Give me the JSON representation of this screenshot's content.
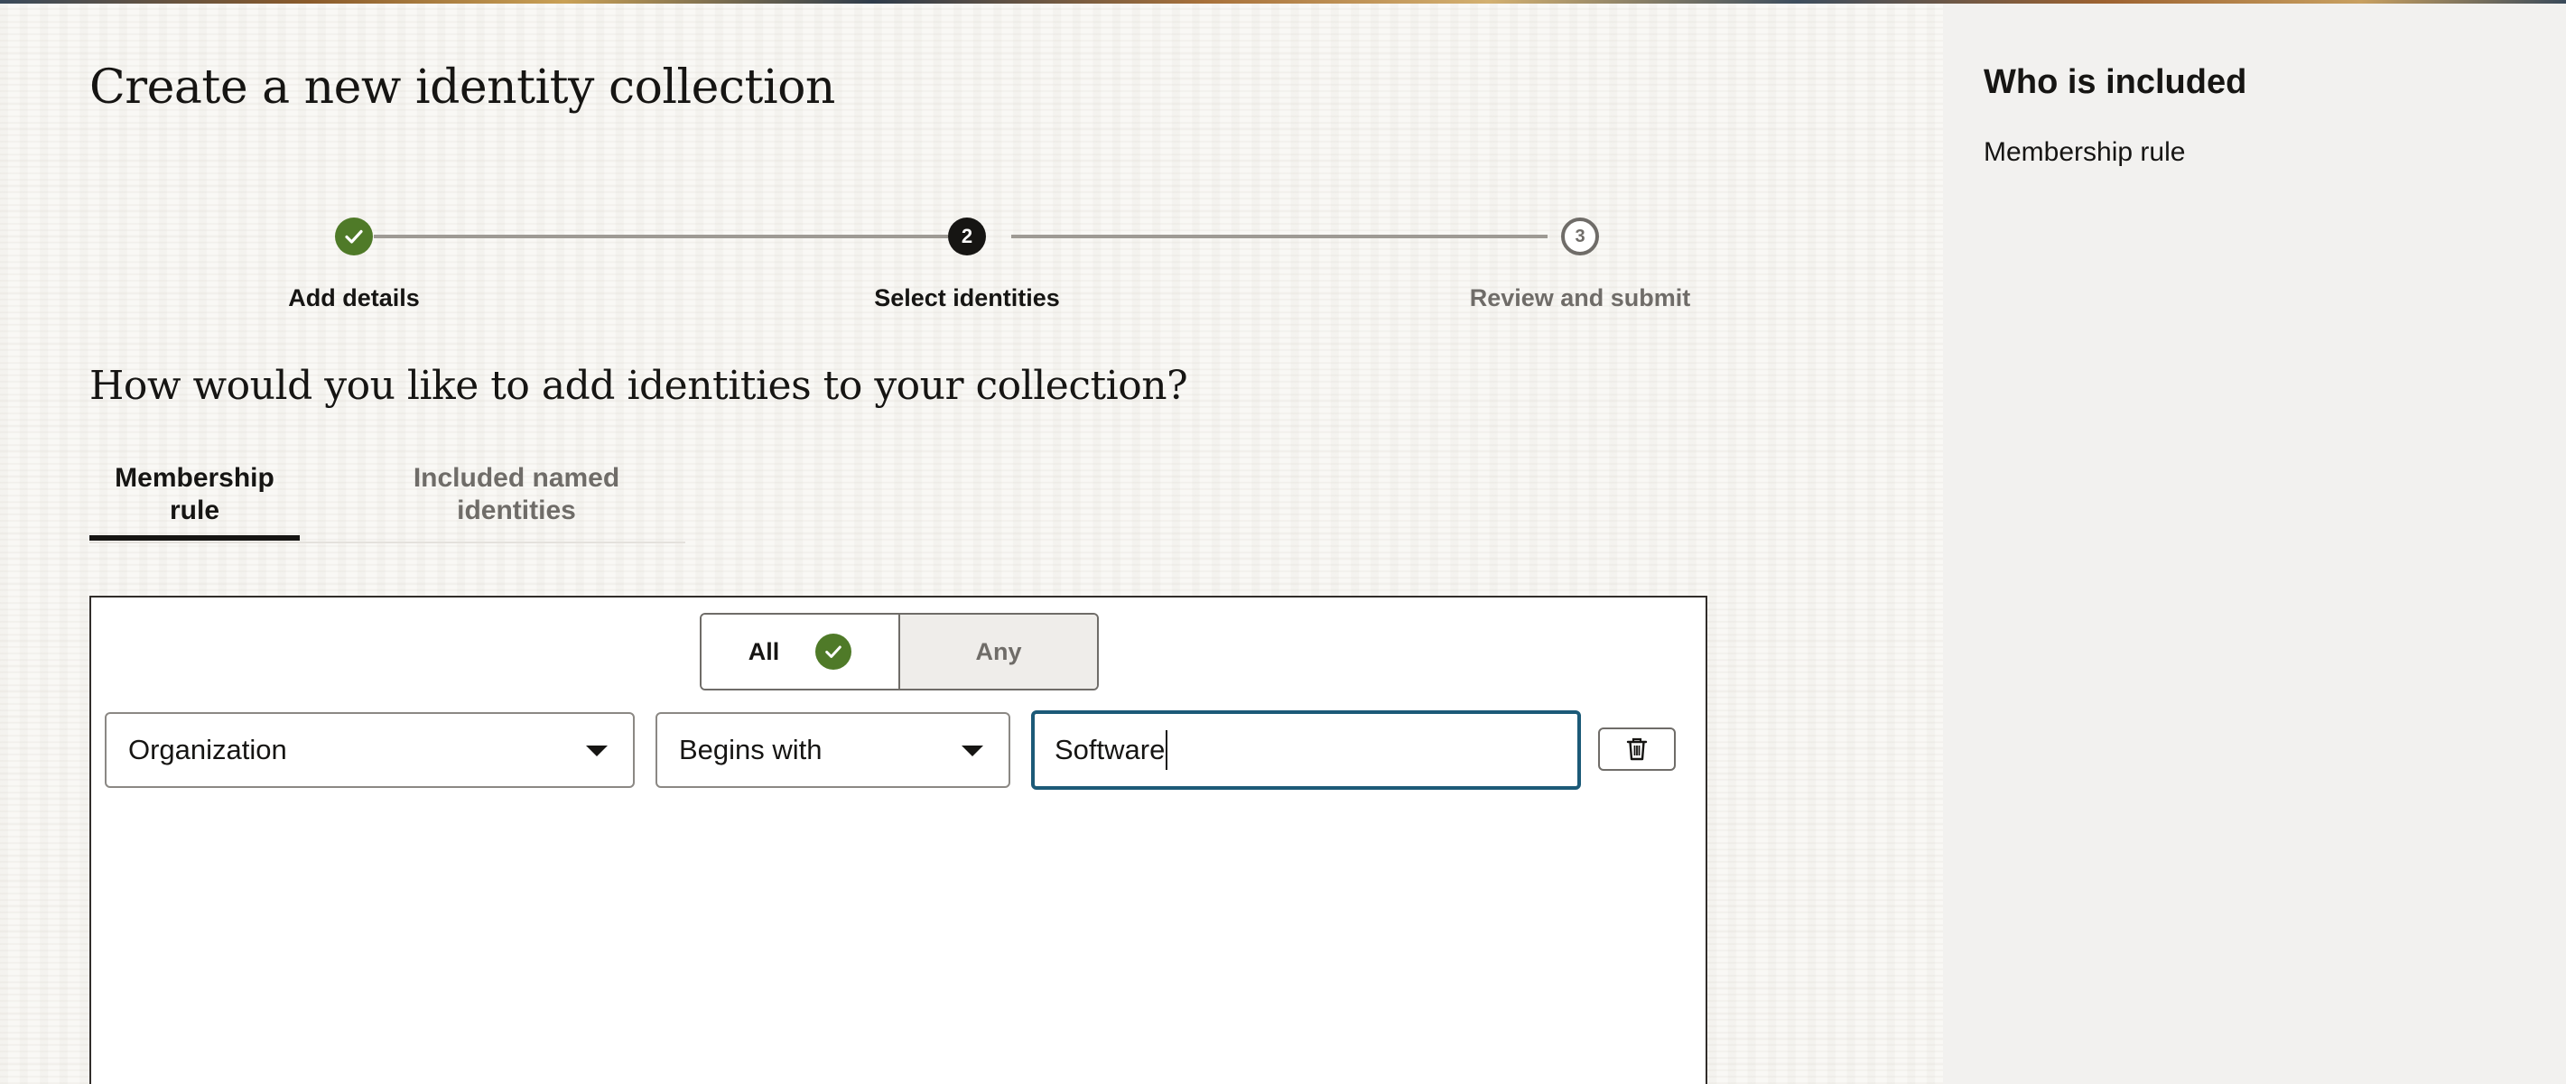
{
  "page": {
    "title": "Create a new identity collection"
  },
  "stepper": {
    "steps": [
      {
        "number": "1",
        "label": "Add details",
        "status": "completed",
        "icon": "check-icon"
      },
      {
        "number": "2",
        "label": "Select identities",
        "status": "current"
      },
      {
        "number": "3",
        "label": "Review and submit",
        "status": "upcoming"
      }
    ]
  },
  "question": "How would you like to add identities to your collection?",
  "tabs": [
    {
      "label": "Membership rule",
      "active": true
    },
    {
      "label": "Included named identities",
      "active": false
    }
  ],
  "rule": {
    "match_toggle": {
      "options": [
        "All",
        "Any"
      ],
      "selected": "All"
    },
    "conditions": [
      {
        "attribute": "Organization",
        "operator": "Begins with",
        "value": "Software"
      }
    ],
    "delete_icon": "trash-icon"
  },
  "side_panel": {
    "title": "Who is included",
    "items": [
      "Membership rule"
    ]
  },
  "colors": {
    "success_green": "#4f7a28",
    "focus_blue": "#1c5a78",
    "text_primary": "#161513",
    "text_secondary": "#6f6c68",
    "side_panel_bg": "#f2f1ef"
  }
}
